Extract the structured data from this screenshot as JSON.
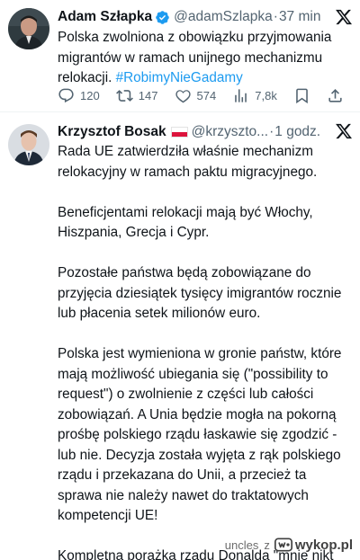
{
  "tweet1": {
    "author_name": "Adam Szłapka",
    "handle": "@adamSzlapka",
    "separator": "·",
    "time": "37 min",
    "text": "Polska zwolniona z obowiązku przyjmowania migrantów w ramach unijnego mechanizmu relokacji.",
    "hashtag": "#RobimyNieGadamy",
    "replies": "120",
    "reposts": "147",
    "likes": "574",
    "views": "7,8k"
  },
  "tweet2": {
    "author_name": "Krzysztof Bosak",
    "handle": "@krzyszto...",
    "separator": "·",
    "time": "1 godz.",
    "paragraphs": [
      "Rada UE zatwierdziła właśnie mechanizm relokacyjny w ramach paktu migracyjnego.",
      "Beneficjentami relokacji mają być Włochy, Hiszpania, Grecja i Cypr.",
      "Pozostałe państwa będą zobowiązane do przyjęcia dziesiątek tysięcy imigrantów rocznie lub płacenia setek milionów euro.",
      "Polska jest wymieniona w gronie państw, które mają możliwość ubiegania się (\"possibility to request\") o zwolnienie z części lub całości zobowiązań. A Unia będzie mogła na pokorną prośbę polskiego rządu łaskawie się zgodzić - lub nie. Decyzja została wyjęta z rąk polskiego rządu i przekazana do Unii, a przecież ta sprawa nie należy nawet do traktatowych kompetencji UE!",
      "Kompletna porażka rządu Donalda \"mnie nikt nie ogra w UE\" Tuska."
    ]
  },
  "watermark": {
    "user": "uncles",
    "connector": "z",
    "site": "wykop.pl"
  },
  "colors": {
    "link": "#1d9bf0",
    "verified": "#1d9bf0",
    "secondary_text": "#536471",
    "primary_text": "#0f1419"
  },
  "icons": {
    "verified": "verified-badge-icon",
    "x_logo": "x-logo-icon",
    "reply": "reply-icon",
    "repost": "repost-icon",
    "like": "heart-icon",
    "views": "views-chart-icon",
    "bookmark": "bookmark-icon",
    "share": "share-icon",
    "flag": "poland-flag-icon"
  }
}
